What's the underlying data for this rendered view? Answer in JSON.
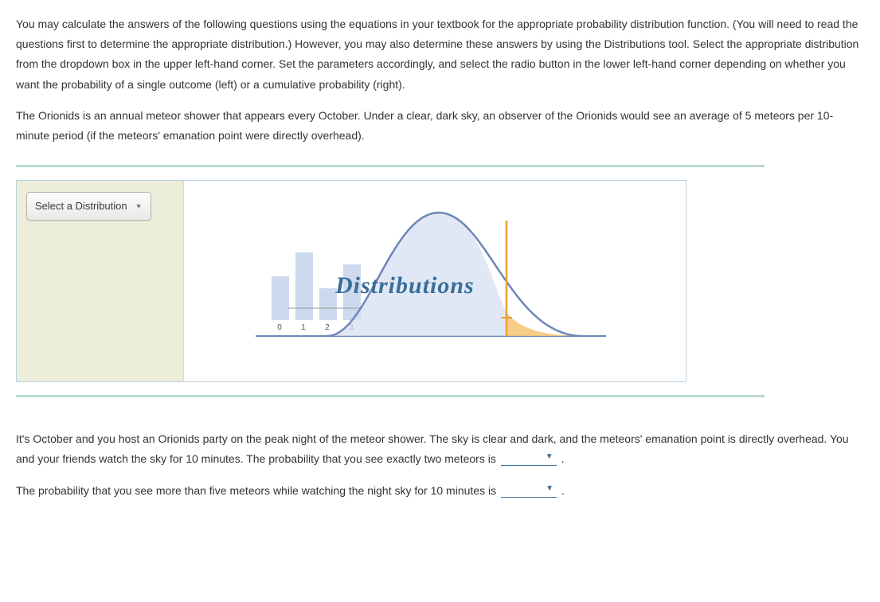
{
  "intro": {
    "p1": "You may calculate the answers of the following questions using the equations in your textbook for the appropriate probability distribution function. (You will need to read the questions first to determine the appropriate distribution.) However, you may also determine these answers by using the Distributions tool. Select the appropriate distribution from the dropdown box in the upper left-hand corner. Set the parameters accordingly, and select the radio button in the lower left-hand corner depending on whether you want the probability of a single outcome (left) or a cumulative probability (right).",
    "p2": "The Orionids is an annual meteor shower that appears every October. Under a clear, dark sky, an observer of the Orionids would see an average of 5 meteors per 10-minute period (if the meteors' emanation point were directly overhead)."
  },
  "tool": {
    "dropdown_label": "Select a Distribution",
    "chart_title": "Distributions",
    "axis_ticks": {
      "t0": "0",
      "t1": "1",
      "t2": "2",
      "t3": "3"
    }
  },
  "questions": {
    "q1_pre": "It's October and you host an Orionids party on the peak night of the meteor shower. The sky is clear and dark, and the meteors' emanation point is directly overhead. You and your friends watch the sky for 10 minutes. The probability that you see exactly two meteors is ",
    "q1_post": " .",
    "q2_pre": "The probability that you see more than five meteors while watching the night sky for 10 minutes is ",
    "q2_post": " ."
  },
  "chart_data": {
    "type": "bar",
    "categories": [
      "0",
      "1",
      "2",
      "3"
    ],
    "values": [
      55,
      85,
      40,
      70
    ],
    "overlay": "normal_curve_with_right_tail_highlight",
    "title": "Distributions",
    "xlabel": "",
    "ylabel": "",
    "ylim": [
      0,
      100
    ]
  }
}
